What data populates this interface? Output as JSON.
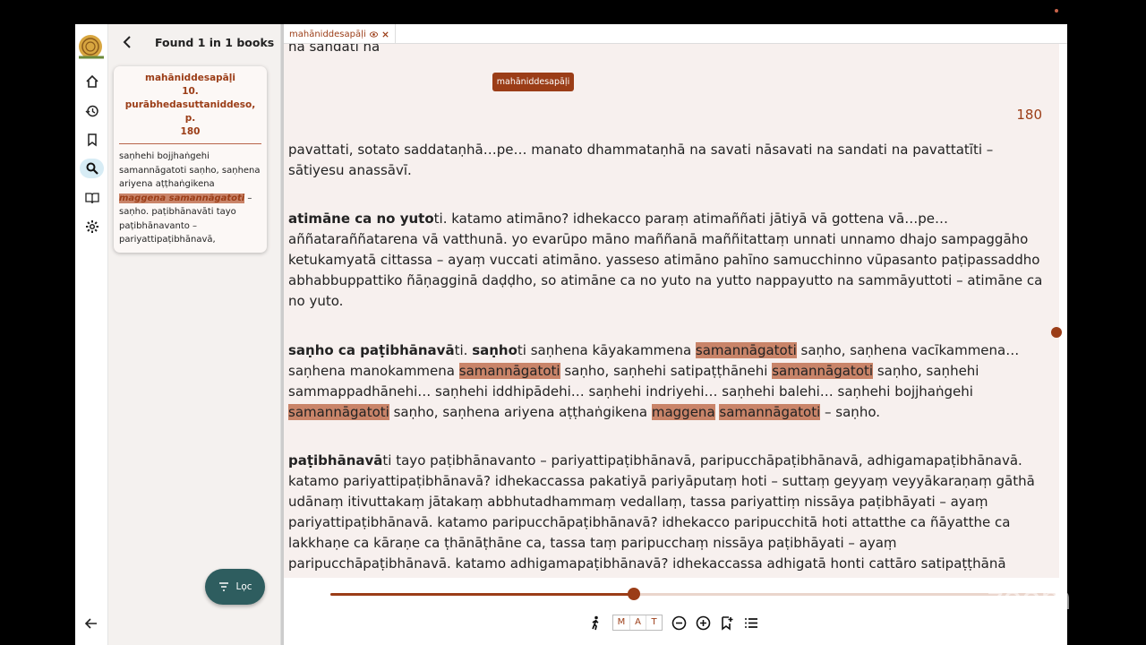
{
  "sidebar": {
    "found_text": "Found 1 in 1 books",
    "result": {
      "title_lines": [
        "mahāniddesapāḷi",
        "10.",
        "purābhedasuttaniddeso, p.",
        "180"
      ],
      "snippet_before": "saṇhehi bojjhaṅgehi samannāgatoti saṇho, saṇhena ariyena aṭṭhaṅgikena ",
      "snippet_highlight": "maggena samannāgatoti",
      "snippet_after": " – saṇho. paṭibhānavāti tayo paṭibhānavanto – pariyattipaṭibhānavā,"
    },
    "filter_label": "Lọc"
  },
  "tab": {
    "label": "mahāniddesapāḷi",
    "tooltip": "mahāniddesapāḷi"
  },
  "reader": {
    "clipped_top_text": "na sandati na",
    "page_number": "180",
    "para1": "pavattati, sotato saddataṇhā…pe… manato dhammataṇhā na savati nāsavati na sandati na pavattatīti – sātiyesu anassāvī.",
    "para2_bold": "atimāne ca no yuto",
    "para2_rest": "ti. katamo atimāno? idhekacco paraṃ atimaññati jātiyā vā gottena vā…pe… aññataraññatarena vā vatthunā. yo evarūpo māno maññanā maññitattaṃ unnati unnamo dhajo sampaggāho ketukamyatā cittassa – ayaṃ vuccati atimāno. yasseso atimāno pahīno samucchinno vūpasanto paṭipassaddho abhabbuppattiko ñāṇagginā daḍḍho, so atimāne ca no yuto na yutto nappayutto na sammāyuttoti – atimāne ca no yuto.",
    "para3": {
      "bold1": "saṇho ca paṭibhānavā",
      "t1": "ti. ",
      "bold2": "saṇho",
      "t2": "ti saṇhena kāyakammena ",
      "hl1": "samannāgatoti",
      "t3": " saṇho, saṇhena vacīkammena… saṇhena manokammena ",
      "hl2": "samannāgatoti",
      "t4": " saṇho, saṇhehi satipaṭṭhānehi ",
      "hl3": "samannāgatoti",
      "t5": " saṇho, saṇhehi sammappadhānehi… saṇhehi iddhipādehi… saṇhehi indriyehi… saṇhehi balehi… saṇhehi bojjhaṅgehi ",
      "hl4": "samannāgatoti",
      "t6": " saṇho, saṇhena ariyena aṭṭhaṅgikena ",
      "hl5": "maggena",
      "t7": " ",
      "hl6": "samannāgatoti",
      "t8": " – saṇho."
    },
    "para4_bold": "paṭibhānavā",
    "para4_rest": "ti tayo paṭibhānavanto – pariyattipaṭibhānavā, paripucchāpaṭibhānavā, adhigamapaṭibhānavā. katamo pariyattipaṭibhānavā? idhekaccassa pakatiyā pariyāputaṃ hoti – suttaṃ geyyaṃ veyyākaraṇaṃ gāthā udānaṃ itivuttakaṃ jātakaṃ abbhutadhammaṃ vedallaṃ, tassa pariyattiṃ nissāya paṭibhāyati – ayaṃ pariyattipaṭibhānavā. katamo paripucchāpaṭibhānavā? idhekacco paripucchitā hoti attatthe ca ñāyatthe ca lakkhaṇe ca kāraṇe ca ṭhānāṭhāne ca, tassa taṃ paripucchaṃ nissāya paṭibhāyati – ayaṃ paripucchāpaṭibhānavā. katamo adhigamapaṭibhānavā? idhekaccassa adhigatā honti cattāro satipaṭṭhānā cattāro sammappadhānā cattāro iddhipādā pañcindriyāni pañca balāni satta bojjhaṅgā ariyo aṭṭhaṅgiko maggo cattāro ariyamaggā cattāri sāmaññaphalāni catasso paṭisambhidāyo cha abhiññāyo, tassa atthe ñāto"
  },
  "bottom_bar": {
    "slider_progress": 0.418,
    "mat": [
      "M",
      "A",
      "T"
    ]
  },
  "overlay": {
    "zoom_watermark": "zoom"
  },
  "colors": {
    "accent": "#9b3d17",
    "highlight": "#c98469",
    "reader_bg": "#f7f0ee",
    "filter_bg": "#2e5d5f"
  },
  "icons": [
    "home-icon",
    "history-icon",
    "bookmark-icon",
    "search-icon",
    "book-icon",
    "gear-icon",
    "back-arrow-icon",
    "filter-icon",
    "eye-icon",
    "close-icon",
    "walk-icon",
    "zoom-out-icon",
    "zoom-in-icon",
    "bookmark-add-icon",
    "list-icon",
    "chevron-down-icon"
  ]
}
